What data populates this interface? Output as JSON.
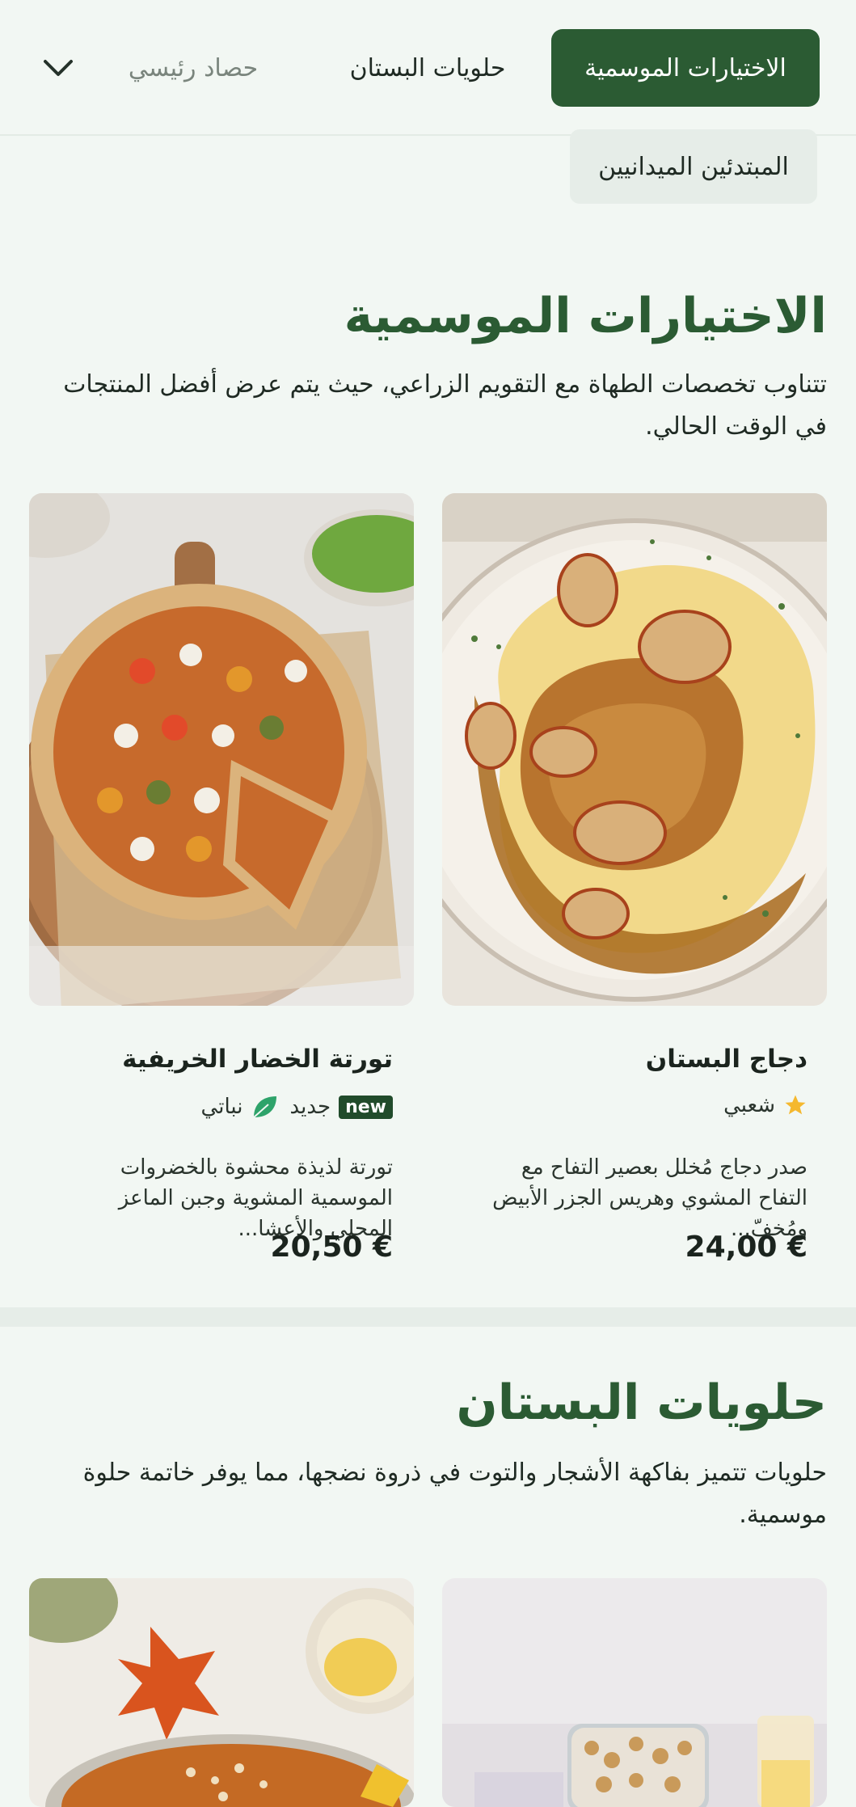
{
  "nav": {
    "tabs": [
      {
        "label": "الاختيارات الموسمية",
        "active": true
      },
      {
        "label": "حلويات البستان",
        "active": false
      },
      {
        "label": "حصاد رئيسي",
        "active": false
      },
      {
        "label": "المبتدئين الميدانيين",
        "active": false
      }
    ],
    "expand_icon": "chevron-down-icon"
  },
  "sections": [
    {
      "title": "الاختيارات الموسمية",
      "description": "تتناوب تخصصات الطهاة مع التقويم الزراعي، حيث يتم عرض أفضل المنتجات في الوقت الحالي.",
      "items": [
        {
          "name": "دجاج البستان",
          "tags": [
            "شعبي"
          ],
          "tag_icon": "star-icon",
          "description": "صدر دجاج مُخلل بعصير التفاح مع التفاح المشوي وهريس الجزر الأبيض ومُخفّ...",
          "price": "24,00 €"
        },
        {
          "name": "تورتة الخضار الخريفية",
          "badge": "new",
          "tags": [
            "جديد",
            "نباتي"
          ],
          "tag_icon": "leaf-icon",
          "description": "تورتة لذيذة محشوة بالخضروات الموسمية المشوية وجبن الماعز المحلي والأعشا...",
          "price": "20,50 €"
        }
      ]
    },
    {
      "title": "حلويات البستان",
      "description": "حلويات تتميز بفاكهة الأشجار والتوت في ذروة نضجها، مما يوفر خاتمة حلوة موسمية."
    }
  ],
  "colors": {
    "accent": "#2b5b33",
    "background": "#f2f7f3",
    "star": "#f5b82e",
    "leaf": "#2ea36a"
  }
}
